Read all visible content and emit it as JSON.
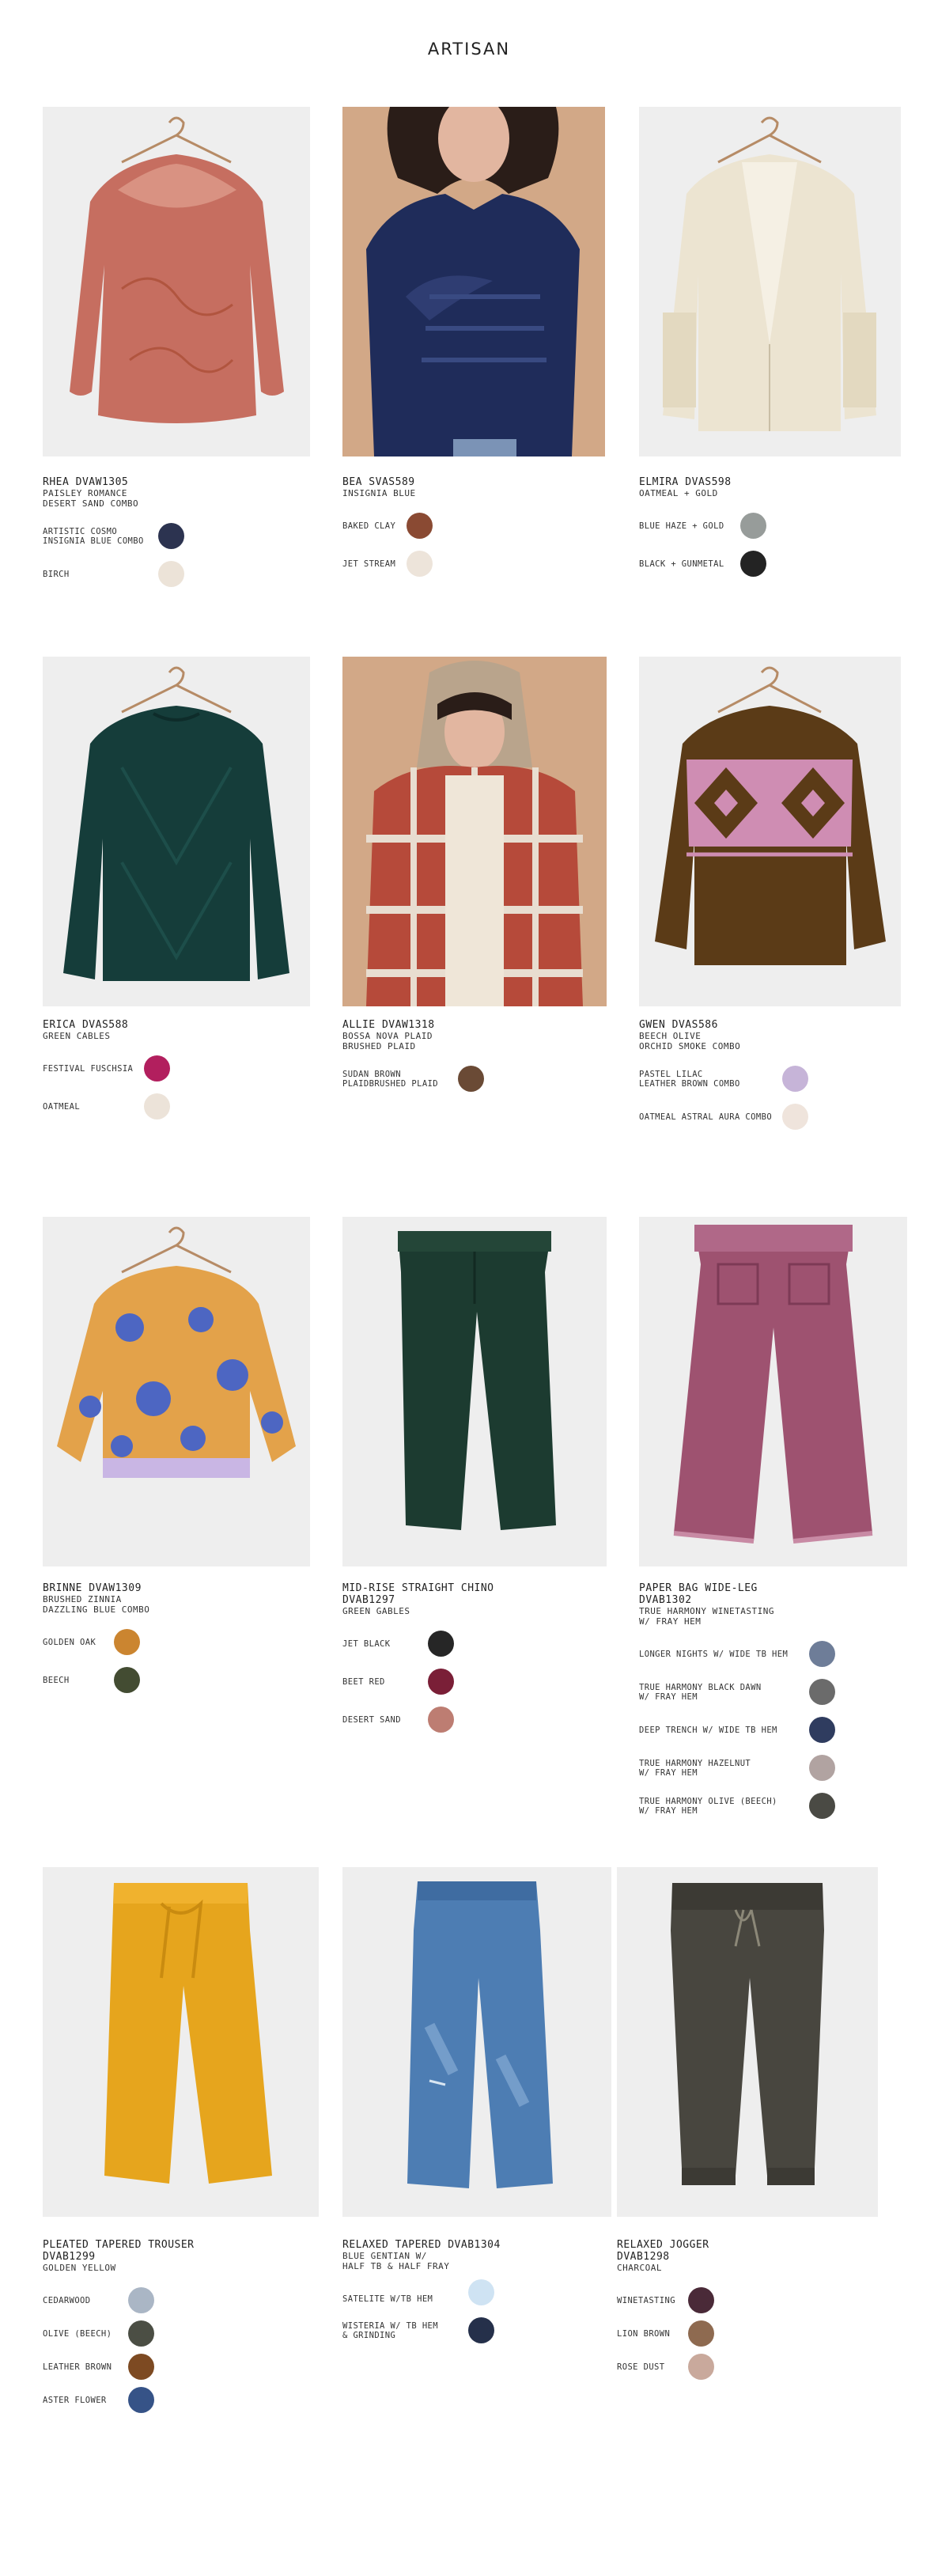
{
  "page": {
    "title": "ARTISAN"
  },
  "products": [
    {
      "name": "RHEA DVAW1305",
      "sub": [
        "PAISLEY ROMANCE",
        "DESERT SAND COMBO"
      ],
      "swatches": [
        {
          "label": "ARTISTIC COSMO\nINSIGNIA BLUE COMBO",
          "color": "#2c3350"
        },
        {
          "label": "BIRCH",
          "color": "#ece3d8"
        }
      ]
    },
    {
      "name": "BEA SVAS589",
      "sub": [
        "INSIGNIA BLUE"
      ],
      "swatches": [
        {
          "label": "BAKED CLAY",
          "color": "#8a4a33"
        },
        {
          "label": "JET STREAM",
          "color": "#ede4da"
        }
      ]
    },
    {
      "name": "ELMIRA DVAS598",
      "sub": [
        "OATMEAL + GOLD"
      ],
      "swatches": [
        {
          "label": "BLUE HAZE + GOLD",
          "color": "#979c9a"
        },
        {
          "label": "BLACK + GUNMETAL",
          "color": "#232323"
        }
      ]
    },
    {
      "name": "ERICA DVAS588",
      "sub": [
        "GREEN CABLES"
      ],
      "swatches": [
        {
          "label": "FESTIVAL FUSCHSIA",
          "color": "#b21f5e"
        },
        {
          "label": "OATMEAL",
          "color": "#ece3d9"
        }
      ]
    },
    {
      "name": "ALLIE DVAW1318",
      "sub": [
        "BOSSA NOVA PLAID",
        "BRUSHED PLAID"
      ],
      "swatches": [
        {
          "label": "SUDAN BROWN\nPLAIDBRUSHED PLAID",
          "color": "#6a4a35"
        }
      ]
    },
    {
      "name": "GWEN DVAS586",
      "sub": [
        "BEECH OLIVE",
        "ORCHID SMOKE COMBO"
      ],
      "swatches": [
        {
          "label": "PASTEL LILAC\nLEATHER BROWN COMBO",
          "color": "#c6b4d8"
        },
        {
          "label": "OATMEAL ASTRAL AURA COMBO",
          "color": "#efe4dc"
        }
      ]
    },
    {
      "name": "BRINNE DVAW1309",
      "sub": [
        "BRUSHED ZINNIA",
        "DAZZLING BLUE COMBO"
      ],
      "swatches": [
        {
          "label": "GOLDEN OAK",
          "color": "#cb8530"
        },
        {
          "label": "BEECH",
          "color": "#434c32"
        }
      ]
    },
    {
      "name": "MID-RISE STRAIGHT CHINO\nDVAB1297",
      "sub": [
        "GREEN GABLES"
      ],
      "swatches": [
        {
          "label": "JET BLACK",
          "color": "#262626"
        },
        {
          "label": "BEET RED",
          "color": "#7a1f37"
        },
        {
          "label": "DESERT SAND",
          "color": "#bd7d72"
        }
      ]
    },
    {
      "name": "PAPER BAG WIDE-LEG\nDVAB1302",
      "sub": [
        "TRUE HARMONY WINETASTING",
        "W/ FRAY HEM"
      ],
      "swatches": [
        {
          "label": "LONGER NIGHTS W/ WIDE TB HEM",
          "color": "#6e7d98"
        },
        {
          "label": "TRUE HARMONY BLACK DAWN\nW/ FRAY HEM",
          "color": "#6b6b6b"
        },
        {
          "label": "DEEP TRENCH W/ WIDE TB HEM",
          "color": "#2f3c5f"
        },
        {
          "label": "TRUE HARMONY HAZELNUT\nW/ FRAY HEM",
          "color": "#b1a3a1"
        },
        {
          "label": "TRUE HARMONY OLIVE (BEECH)\nW/ FRAY HEM",
          "color": "#4a4a44"
        }
      ]
    },
    {
      "name": "PLEATED TAPERED TROUSER\nDVAB1299",
      "sub": [
        "GOLDEN YELLOW"
      ],
      "swatches": [
        {
          "label": "CEDARWOOD",
          "color": "#aab6c5"
        },
        {
          "label": "OLIVE (BEECH)",
          "color": "#4b4e44"
        },
        {
          "label": "LEATHER BROWN",
          "color": "#7d4a22"
        },
        {
          "label": "ASTER FLOWER",
          "color": "#365387"
        }
      ]
    },
    {
      "name": "RELAXED TAPERED DVAB1304",
      "sub": [
        "BLUE GENTIAN W/",
        "HALF TB & HALF FRAY"
      ],
      "swatches": [
        {
          "label": "SATELITE W/TB HEM",
          "color": "#cfe3f3"
        },
        {
          "label": "WISTERIA W/ TB HEM\n& GRINDING",
          "color": "#25304a"
        }
      ]
    },
    {
      "name": "RELAXED JOGGER\nDVAB1298",
      "sub": [
        "CHARCOAL"
      ],
      "swatches": [
        {
          "label": "WINETASTING",
          "color": "#4a2a38"
        },
        {
          "label": "LION BROWN",
          "color": "#8e6a50"
        },
        {
          "label": "ROSE DUST",
          "color": "#c9a99c"
        }
      ]
    }
  ]
}
